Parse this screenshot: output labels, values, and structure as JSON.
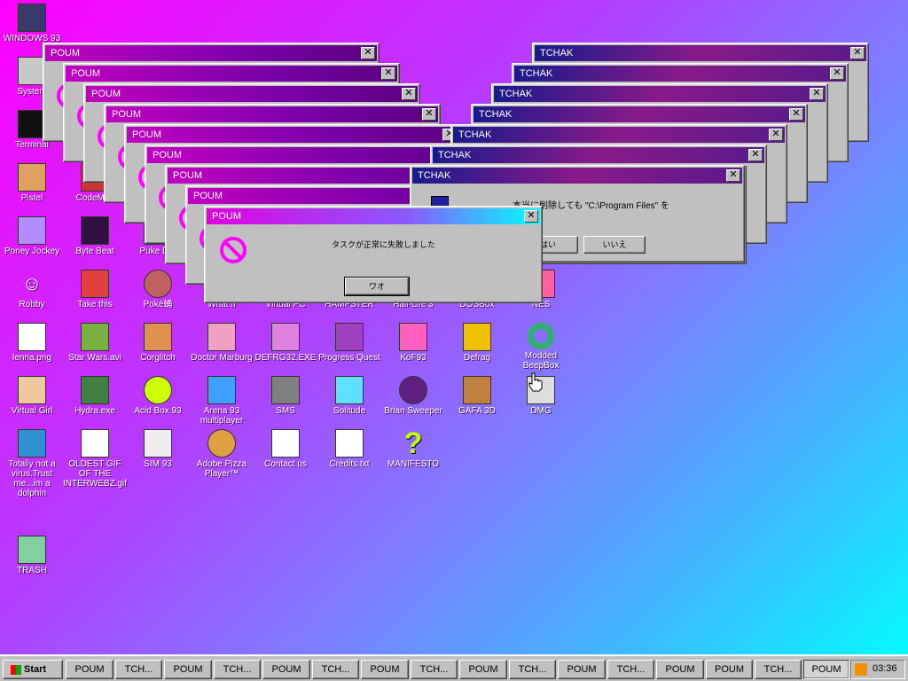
{
  "desktop_icons": [
    {
      "id": "windows93",
      "label": "WINDOWS 93",
      "icon": "computer-icon"
    },
    {
      "id": "system",
      "label": "System",
      "icon": "system-icon"
    },
    {
      "id": "terminal",
      "label": "Terminal",
      "icon": "terminal-icon"
    },
    {
      "id": "pistel",
      "label": "Pistel",
      "icon": "palette-icon"
    },
    {
      "id": "codemirror",
      "label": "CodeMi...",
      "icon": "code-icon"
    },
    {
      "id": "poney",
      "label": "Poney Jockey",
      "icon": "pony-icon"
    },
    {
      "id": "bytebeat",
      "label": "Byte Beat",
      "icon": "bytebeat-icon"
    },
    {
      "id": "puke",
      "label": "Puke D...",
      "icon": "puke-icon"
    },
    {
      "id": "robby",
      "label": "Robby",
      "icon": "stickman-icon"
    },
    {
      "id": "takethis",
      "label": "Take this",
      "icon": "character-icon"
    },
    {
      "id": "pokemon",
      "label": "Poké蛹",
      "icon": "cookie-icon"
    },
    {
      "id": "whatif",
      "label": "What If",
      "icon": "whatif-icon"
    },
    {
      "id": "virtualpc",
      "label": "Virtual PC",
      "icon": "pc-icon"
    },
    {
      "id": "hampster",
      "label": "HAMPSTER",
      "icon": "hamster-icon"
    },
    {
      "id": "halflife",
      "label": "Half-Life 3",
      "icon": "halflife-icon"
    },
    {
      "id": "dosbox",
      "label": "DOSBox",
      "icon": "dosbox-icon"
    },
    {
      "id": "nes",
      "label": "NES",
      "icon": "nes-icon"
    },
    {
      "id": "lenna",
      "label": "lenna.png",
      "icon": "image-file-icon"
    },
    {
      "id": "starwars",
      "label": "Star Wars.avi",
      "icon": "yoda-icon"
    },
    {
      "id": "corglitch",
      "label": "Corglitch",
      "icon": "corgi-icon"
    },
    {
      "id": "doctor",
      "label": "Doctor Marburg",
      "icon": "robot-icon"
    },
    {
      "id": "defrag32",
      "label": "DEFRG32.EXE",
      "icon": "floppy-face-icon"
    },
    {
      "id": "progress",
      "label": "Progress Quest",
      "icon": "swords-icon"
    },
    {
      "id": "kof93",
      "label": "KoF93",
      "icon": "fighter-icon"
    },
    {
      "id": "defrag",
      "label": "Defrag",
      "icon": "defrag-icon"
    },
    {
      "id": "beepbox",
      "label": "Modded BeepBox",
      "icon": "ring-icon"
    },
    {
      "id": "virtualgirl",
      "label": "Virtual Girl",
      "icon": "face-icon"
    },
    {
      "id": "hydra",
      "label": "Hydra.exe",
      "icon": "hydra-icon"
    },
    {
      "id": "acidbox",
      "label": "Acid Box 93",
      "icon": "smiley-icon"
    },
    {
      "id": "arena",
      "label": "Arena 93 multiplayer",
      "icon": "cube-icon"
    },
    {
      "id": "sms",
      "label": "SMS",
      "icon": "sms-icon"
    },
    {
      "id": "solitude",
      "label": "Solitude",
      "icon": "solitude-icon"
    },
    {
      "id": "brian",
      "label": "Brian Sweeper",
      "icon": "mine-icon"
    },
    {
      "id": "gafa",
      "label": "GAFA 3D",
      "icon": "doomguy-icon"
    },
    {
      "id": "dmg",
      "label": "DMG",
      "icon": "disk-image-icon"
    },
    {
      "id": "dolphin",
      "label": "Totally not a virus.Trust me...im a dolphin",
      "icon": "dolphin-icon"
    },
    {
      "id": "oldestgif",
      "label": "OLDEST GIF OF THE INTERWEBZ.gif",
      "icon": "image-file-icon"
    },
    {
      "id": "sim93",
      "label": "SIM 93",
      "icon": "sim-icon"
    },
    {
      "id": "pizza",
      "label": "Adobe Pizza Player™",
      "icon": "pizza-icon"
    },
    {
      "id": "contact",
      "label": "Contact us",
      "icon": "contact-icon"
    },
    {
      "id": "credits",
      "label": "Credits.txt",
      "icon": "text-file-icon"
    },
    {
      "id": "manifesto",
      "label": "MANIFESTO",
      "icon": "question-icon"
    },
    {
      "id": "trash",
      "label": "TRASH",
      "icon": "trash-icon"
    }
  ],
  "poum_title": "POUM",
  "tchak_title": "TCHAK",
  "close_glyph": "✕",
  "poum_dialog": {
    "message": "タスクが正常に失敗しました",
    "ok_label": "ワオ",
    "icon": "no-entry-icon"
  },
  "tchak_dialog": {
    "message": "本当に削除しても \"C:\\Program Files\" を",
    "yes_label": "はい",
    "no_label": "いいえ"
  },
  "taskbar": {
    "start_label": "Start",
    "buttons": [
      "POUM",
      "TCH...",
      "POUM",
      "TCH...",
      "POUM",
      "TCH...",
      "POUM",
      "TCH...",
      "POUM",
      "TCH...",
      "POUM",
      "TCH...",
      "POUM",
      "POUM",
      "TCH...",
      "POUM"
    ],
    "clock": "03:36",
    "tray_icon": "rss-icon"
  },
  "colors": {
    "accent": "#ff00ff",
    "cyan": "#00ffff"
  }
}
